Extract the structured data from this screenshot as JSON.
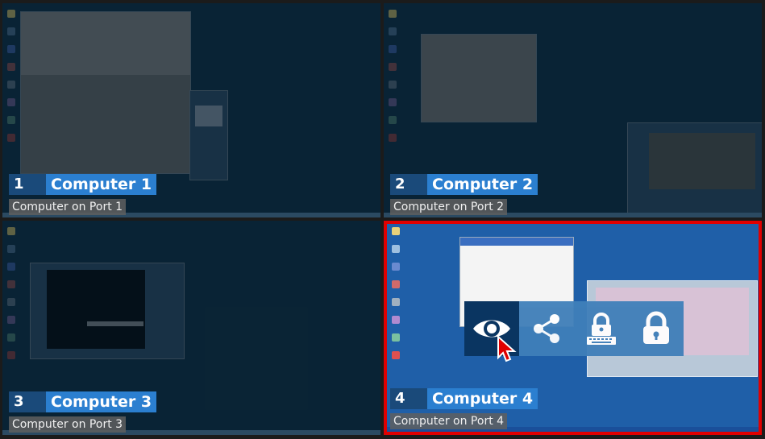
{
  "quadrants": [
    {
      "number": "1",
      "name": "Computer 1",
      "description": "Computer on Port 1"
    },
    {
      "number": "2",
      "name": "Computer 2",
      "description": "Computer on Port 2"
    },
    {
      "number": "3",
      "name": "Computer 3",
      "description": "Computer on Port 3"
    },
    {
      "number": "4",
      "name": "Computer 4",
      "description": "Computer on Port 4"
    }
  ],
  "overlay": {
    "icons": [
      "eye-icon",
      "share-icon",
      "keyboard-lock-icon",
      "lock-icon"
    ]
  },
  "colors": {
    "selected_border": "#e00000",
    "label_number_bg": "#1a4a7a",
    "label_name_bg": "#2b7fd0",
    "desktop_bg": "#0d2b3f",
    "active_desktop_bg": "#1f5fa8"
  }
}
